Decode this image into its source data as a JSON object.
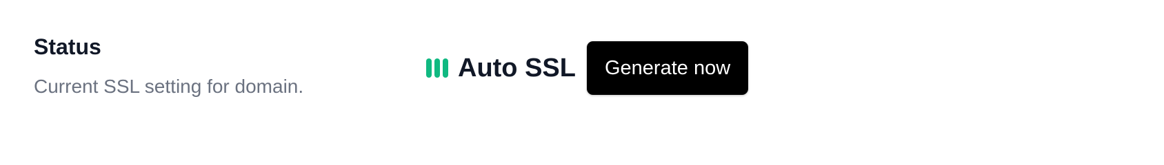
{
  "status": {
    "title": "Status",
    "description": "Current SSL setting for domain.",
    "indicator": {
      "icon": "signal-bars-icon",
      "color": "#10b981",
      "bars": 3
    },
    "ssl_mode": "Auto SSL",
    "generate_button_label": "Generate now"
  },
  "colors": {
    "title": "#111827",
    "description": "#6b7280",
    "button_bg": "#000000",
    "button_text": "#ffffff"
  }
}
